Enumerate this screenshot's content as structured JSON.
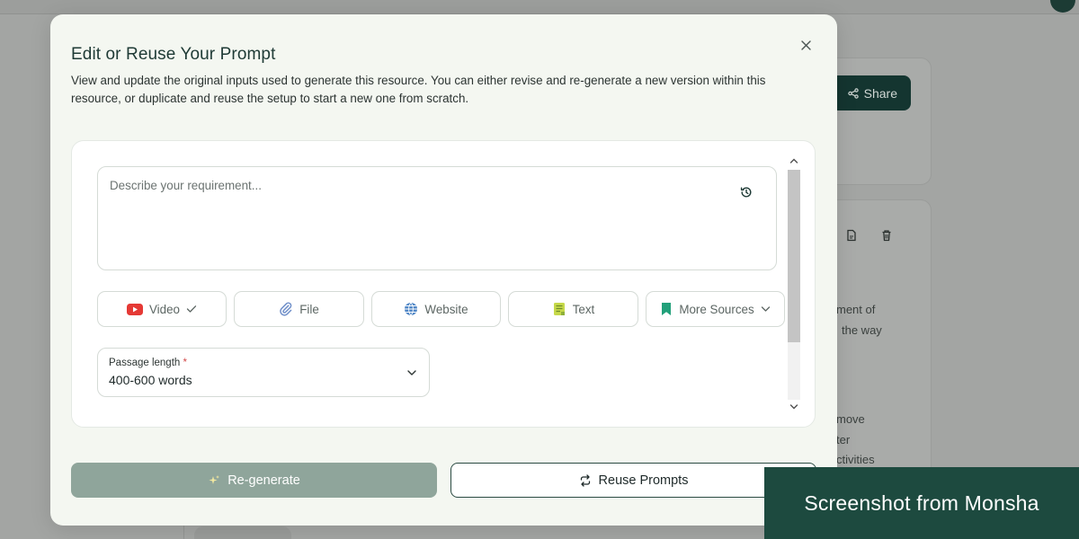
{
  "background": {
    "share_label": "Share",
    "text_lines": [
      "ment of",
      "the way",
      "move",
      "ter",
      "ctivities"
    ]
  },
  "modal": {
    "title": "Edit or Reuse Your Prompt",
    "description": "View and update the original inputs used to generate this resource. You can either revise and re-generate a new version within this resource, or duplicate and reuse the setup to start a new one from scratch.",
    "prompt": {
      "placeholder": "Describe your requirement...",
      "value": ""
    },
    "sources": [
      {
        "label": "Video",
        "icon": "youtube-icon",
        "selected": true
      },
      {
        "label": "File",
        "icon": "paperclip-icon"
      },
      {
        "label": "Website",
        "icon": "globe-icon"
      },
      {
        "label": "Text",
        "icon": "text-note-icon"
      },
      {
        "label": "More Sources",
        "icon": "bookmark-icon",
        "dropdown": true
      }
    ],
    "passage_length": {
      "label": "Passage length",
      "required_mark": "*",
      "value": "400-600 words"
    },
    "buttons": {
      "regenerate": "Re-generate",
      "reuse": "Reuse Prompts"
    }
  },
  "watermark": "Screenshot from Monsha",
  "colors": {
    "accent_dark": "#143530",
    "regenerate_bg": "#8fa59b",
    "modal_bg": "#f4f7f1",
    "watermark_bg": "#1d4a3f"
  }
}
